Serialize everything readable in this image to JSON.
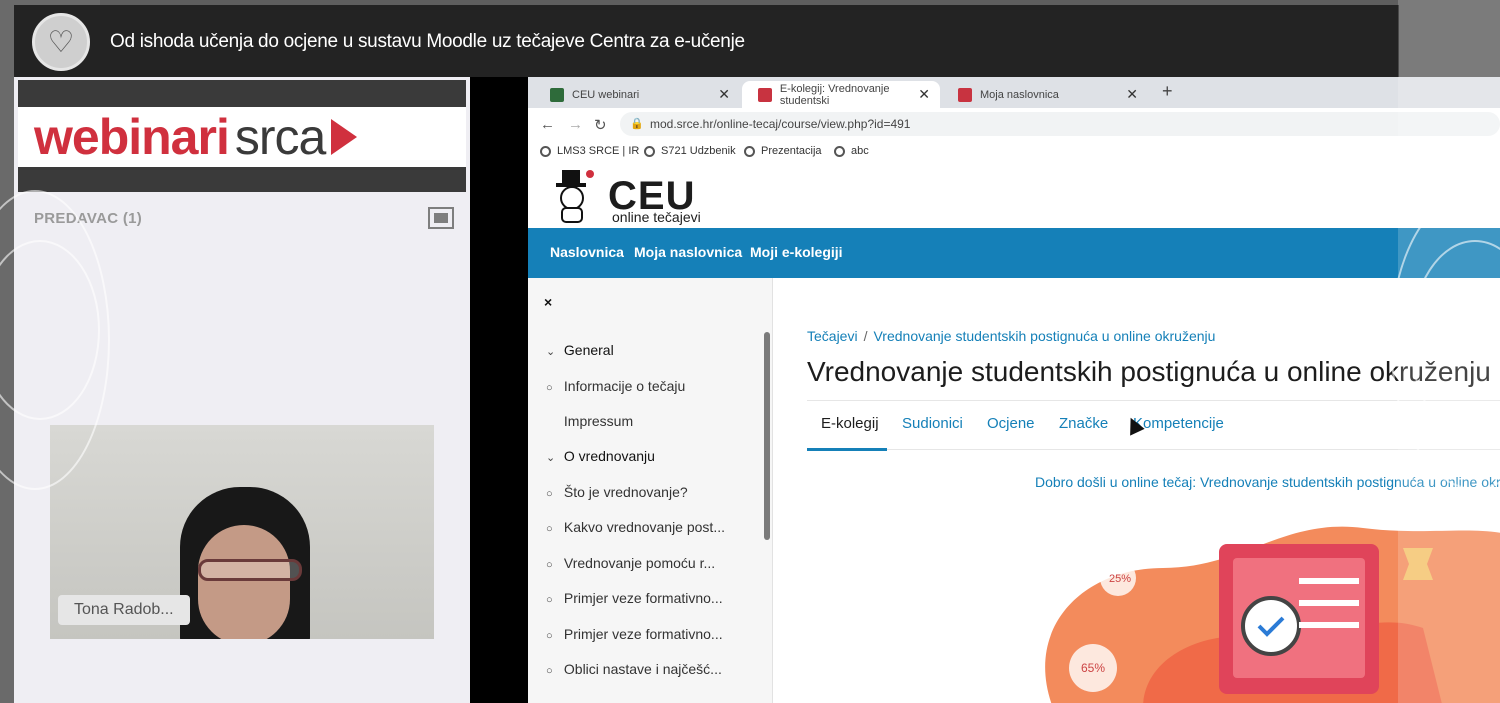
{
  "app": {
    "title": "Od ishoda učenja do ocjene u sustavu Moodle uz tečajeve Centra za e-učenje"
  },
  "brand": {
    "part1": "webinari",
    "part2": "srca"
  },
  "presenter_panel": {
    "label": "PREDAVAC (1)",
    "presenter_name": "Tona Radob..."
  },
  "browser": {
    "tabs": [
      {
        "label": "CEU webinari",
        "favicon_color": "#2e6b3a"
      },
      {
        "label": "E-kolegij: Vrednovanje studentski",
        "favicon_color": "#c83340"
      },
      {
        "label": "Moja naslovnica",
        "favicon_color": "#c83340"
      }
    ],
    "url": "mod.srce.hr/online-tecaj/course/view.php?id=491",
    "bookmarks": [
      "LMS3 SRCE | IR",
      "S721 Udzbenik",
      "Prezentacija",
      "abc"
    ]
  },
  "site": {
    "logo_big": "CEU",
    "logo_small": "online tečajevi",
    "nav": [
      "Naslovnica",
      "Moja naslovnica",
      "Moji e-kolegiji"
    ]
  },
  "drawer": {
    "close": "×",
    "items": [
      {
        "label": "General",
        "type": "section"
      },
      {
        "label": "Informacije o tečaju",
        "type": "item"
      },
      {
        "label": "Impressum",
        "type": "plain"
      },
      {
        "label": "O vrednovanju",
        "type": "section"
      },
      {
        "label": "Što je vrednovanje?",
        "type": "item"
      },
      {
        "label": "Kakvo vrednovanje post...",
        "type": "item"
      },
      {
        "label": "Vrednovanje pomoću r...",
        "type": "item"
      },
      {
        "label": "Primjer veze formativno...",
        "type": "item"
      },
      {
        "label": "Primjer veze formativno...",
        "type": "item"
      },
      {
        "label": "Oblici nastave i najčešć...",
        "type": "item"
      }
    ]
  },
  "course": {
    "breadcrumb": [
      "Tečajevi",
      "Vrednovanje studentskih postignuća u online okruženju"
    ],
    "title": "Vrednovanje studentskih postignuća u online okruženju",
    "tabs": [
      "E-kolegij",
      "Sudionici",
      "Ocjene",
      "Značke",
      "Kompetencije"
    ],
    "active_tab": "E-kolegij",
    "welcome": "Dobro došli u online tečaj: Vrednovanje studentskih postignuća u online okruženju",
    "badges": [
      "25%",
      "65%"
    ]
  },
  "colors": {
    "brand_red": "#d0303e",
    "nav_blue": "#1580b8",
    "titlebar": "#232323"
  }
}
